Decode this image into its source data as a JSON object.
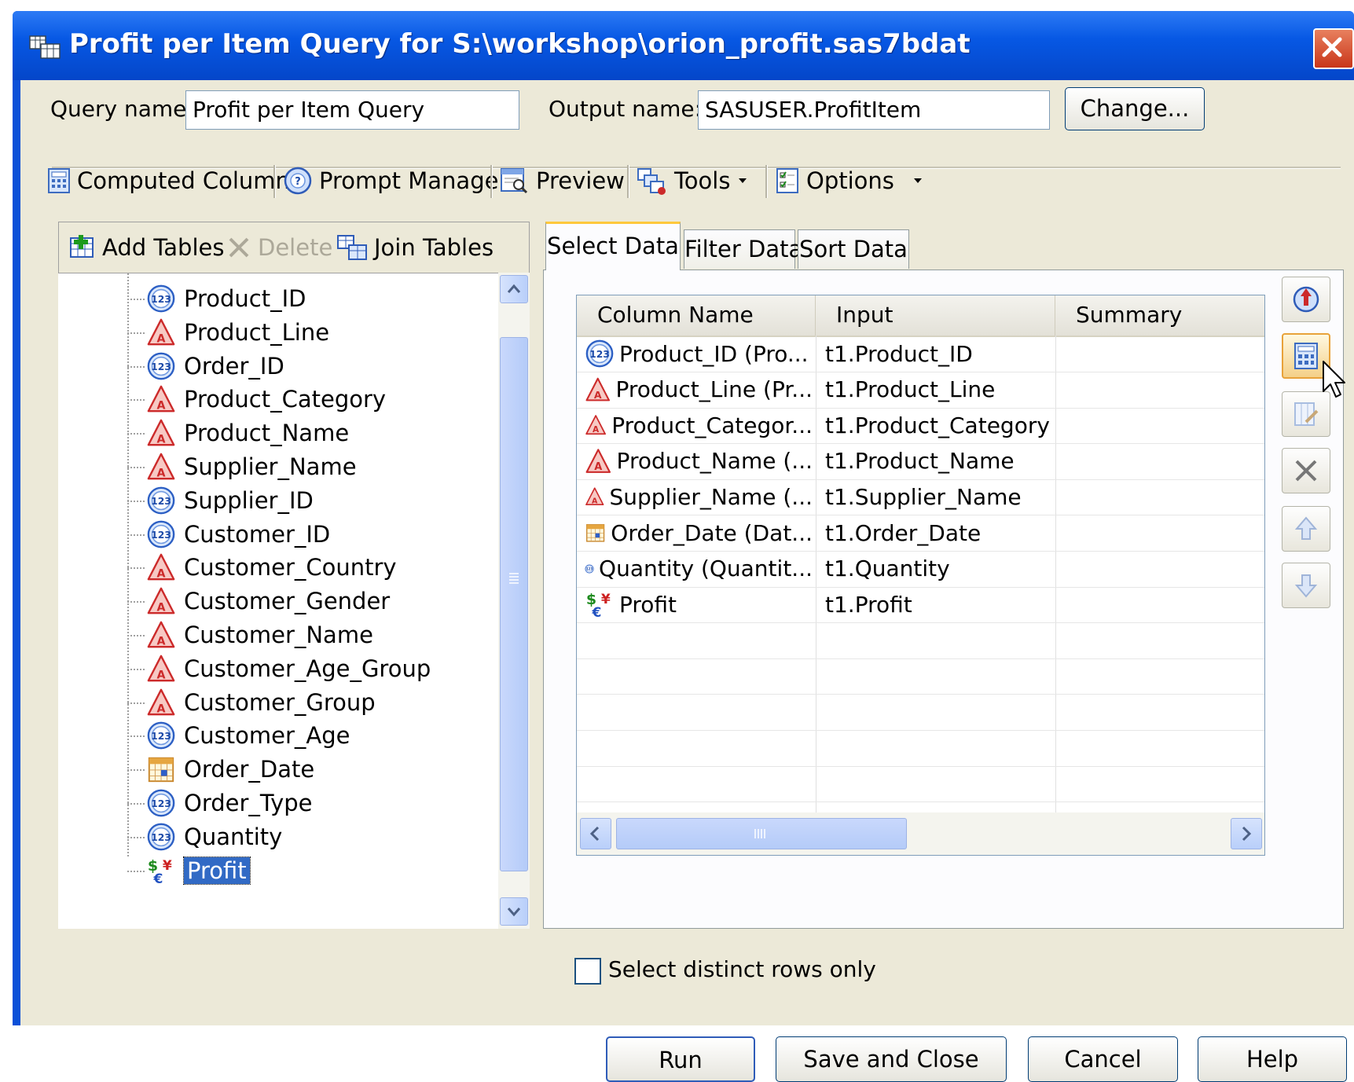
{
  "window": {
    "title": "Profit per Item Query for S:\\workshop\\orion_profit.sas7bdat"
  },
  "header": {
    "query_name_label": "Query name:",
    "query_name_value": "Profit per Item Query",
    "output_name_label": "Output name:",
    "output_name_value": "SASUSER.ProfitItem",
    "change_button": "Change..."
  },
  "toolbar": {
    "computed_columns": "Computed Columns",
    "prompt_manager": "Prompt Manager",
    "preview": "Preview",
    "tools": "Tools",
    "options": "Options"
  },
  "left_toolbar": {
    "add_tables": "Add Tables",
    "delete": "Delete",
    "join_tables": "Join Tables"
  },
  "tree": {
    "items": [
      {
        "label": "Product_ID",
        "icon": "numeric-icon"
      },
      {
        "label": "Product_Line",
        "icon": "character-icon"
      },
      {
        "label": "Order_ID",
        "icon": "numeric-icon"
      },
      {
        "label": "Product_Category",
        "icon": "character-icon"
      },
      {
        "label": "Product_Name",
        "icon": "character-icon"
      },
      {
        "label": "Supplier_Name",
        "icon": "character-icon"
      },
      {
        "label": "Supplier_ID",
        "icon": "numeric-icon"
      },
      {
        "label": "Customer_ID",
        "icon": "numeric-icon"
      },
      {
        "label": "Customer_Country",
        "icon": "character-icon"
      },
      {
        "label": "Customer_Gender",
        "icon": "character-icon"
      },
      {
        "label": "Customer_Name",
        "icon": "character-icon"
      },
      {
        "label": "Customer_Age_Group",
        "icon": "character-icon"
      },
      {
        "label": "Customer_Group",
        "icon": "character-icon"
      },
      {
        "label": "Customer_Age",
        "icon": "numeric-icon"
      },
      {
        "label": "Order_Date",
        "icon": "date-icon"
      },
      {
        "label": "Order_Type",
        "icon": "numeric-icon"
      },
      {
        "label": "Quantity",
        "icon": "numeric-icon"
      },
      {
        "label": "Profit",
        "icon": "currency-icon",
        "selected": true
      }
    ]
  },
  "tabs": [
    {
      "label": "Select Data",
      "active": true
    },
    {
      "label": "Filter Data",
      "active": false
    },
    {
      "label": "Sort Data",
      "active": false
    }
  ],
  "grid": {
    "columns": [
      "Column Name",
      "Input",
      "Summary"
    ],
    "rows": [
      {
        "icon": "numeric-icon",
        "name": "Product_ID (Pro...",
        "input": "t1.Product_ID",
        "summary": ""
      },
      {
        "icon": "character-icon",
        "name": "Product_Line (Pr...",
        "input": "t1.Product_Line",
        "summary": ""
      },
      {
        "icon": "character-icon",
        "name": "Product_Categor...",
        "input": "t1.Product_Category",
        "summary": ""
      },
      {
        "icon": "character-icon",
        "name": "Product_Name (...",
        "input": "t1.Product_Name",
        "summary": ""
      },
      {
        "icon": "character-icon",
        "name": "Supplier_Name (...",
        "input": "t1.Supplier_Name",
        "summary": ""
      },
      {
        "icon": "date-icon",
        "name": "Order_Date (Dat...",
        "input": "t1.Order_Date",
        "summary": ""
      },
      {
        "icon": "numeric-icon",
        "name": "Quantity (Quantit...",
        "input": "t1.Quantity",
        "summary": ""
      },
      {
        "icon": "currency-icon",
        "name": "Profit",
        "input": "t1.Profit",
        "summary": ""
      }
    ]
  },
  "distinct_rows": {
    "label": "Select distinct rows only",
    "checked": false
  },
  "footer": {
    "run": "Run",
    "save_and_close": "Save and Close",
    "cancel": "Cancel",
    "help": "Help"
  },
  "colors": {
    "title_bar": "#0758e4",
    "dialog_bg": "#ece9d8",
    "selection": "#316ac5"
  }
}
